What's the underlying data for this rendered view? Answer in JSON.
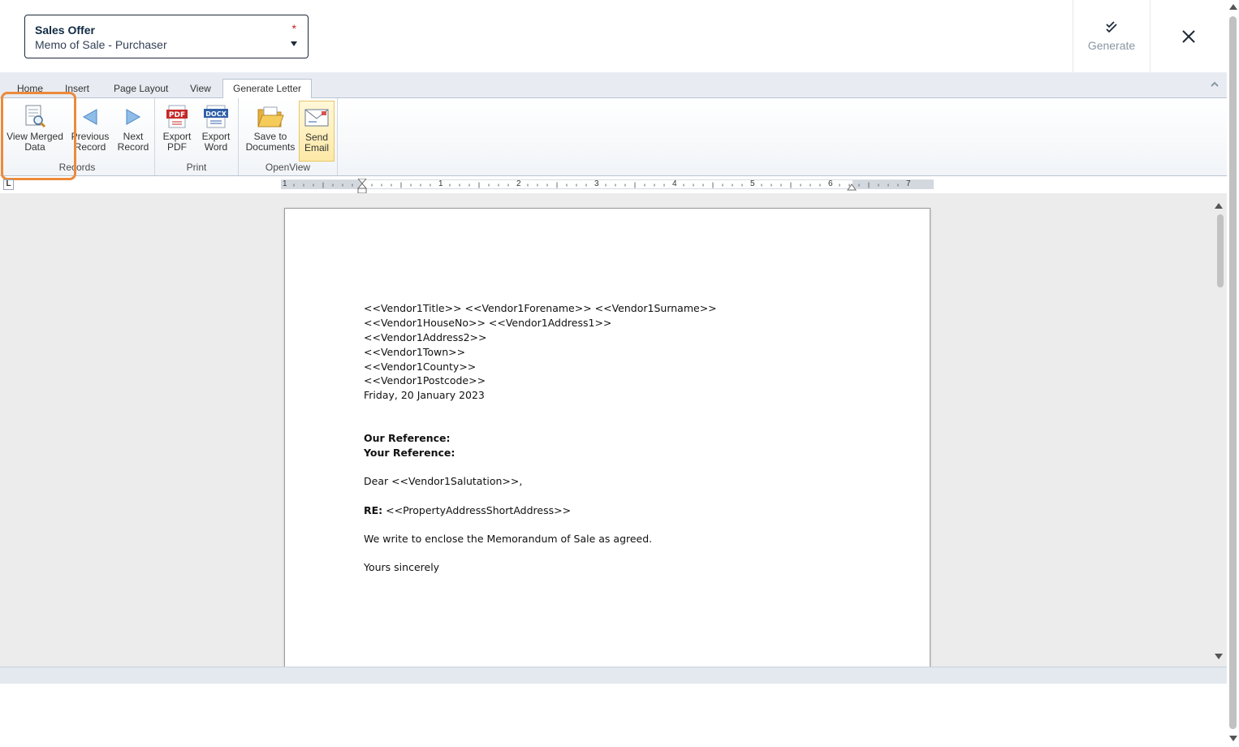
{
  "header": {
    "template_label": "Sales Offer",
    "template_value": "Memo of Sale - Purchaser",
    "required_mark": "*",
    "generate_label": "Generate"
  },
  "ribbon": {
    "tabs": [
      "Home",
      "Insert",
      "Page Layout",
      "View",
      "Generate Letter"
    ],
    "active_tab": "Generate Letter",
    "groups": {
      "records": {
        "label": "Records",
        "view_merged": [
          "View Merged",
          "Data"
        ],
        "previous": [
          "Previous",
          "Record"
        ],
        "next": [
          "Next",
          "Record"
        ]
      },
      "print": {
        "label": "Print",
        "export_pdf": [
          "Export",
          "PDF"
        ],
        "export_word": [
          "Export",
          "Word"
        ],
        "pdf_badge": "PDF",
        "docx_badge": "DOCX"
      },
      "openview": {
        "label": "OpenView",
        "save_docs": [
          "Save to",
          "Documents"
        ],
        "send_email": [
          "Send",
          "Email"
        ]
      }
    },
    "accent_color": "#ec8a3b"
  },
  "ruler": {
    "corner": "L",
    "numbers": [
      "1",
      "1",
      "2",
      "3",
      "4",
      "5",
      "6",
      "7"
    ]
  },
  "letter": {
    "address": [
      "<<Vendor1Title>> <<Vendor1Forename>> <<Vendor1Surname>>",
      "<<Vendor1HouseNo>> <<Vendor1Address1>>",
      "<<Vendor1Address2>>",
      "<<Vendor1Town>>",
      "<<Vendor1County>>",
      "<<Vendor1Postcode>>"
    ],
    "date": "Friday, 20 January 2023",
    "our_reference_label": "Our Reference:",
    "your_reference_label": "Your Reference:",
    "salutation": "Dear <<Vendor1Salutation>>,",
    "re_label": "RE:",
    "re_value": "<<PropertyAddressShortAddress>>",
    "body": "We write to enclose the Memorandum of Sale as agreed.",
    "closing": "Yours sincerely"
  }
}
